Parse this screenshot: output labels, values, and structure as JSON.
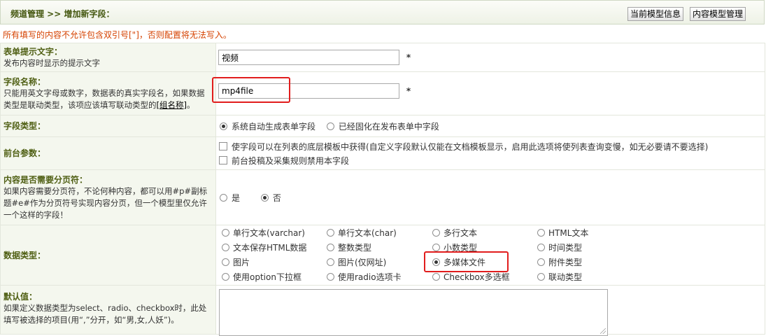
{
  "header": {
    "breadcrumb": "频道管理 >> 增加新字段：",
    "btn_model_info": "当前模型信息",
    "btn_model_manage": "内容模型管理"
  },
  "notice": "所有填写的内容不允许包含双引号[\"]，否则配置将无法写入。",
  "rows": {
    "form_hint": {
      "title": "表单提示文字：",
      "desc": "发布内容时显示的提示文字",
      "value": "视频",
      "required": "*"
    },
    "field_name": {
      "title": "字段名称：",
      "desc_1": "只能用英文字母或数字，数据表的真实字段名，如果数据",
      "desc_2": "类型是联动类型，该项应该填写联动类型的",
      "desc_link": "[组名称]",
      "desc_end": "。",
      "value": "mp4file",
      "required": "*"
    },
    "field_type": {
      "title": "字段类型：",
      "opt_1": "系统自动生成表单字段",
      "opt_2": "已经固化在发布表单中字段",
      "selected": "系统自动生成表单字段"
    },
    "frontend": {
      "title": "前台参数：",
      "chk_1": "使字段可以在列表的底层模板中获得(自定义字段默认仅能在文档模板显示，启用此选项将使列表查询变慢，如无必要请不要选择)",
      "chk_2": "前台投稿及采集规则禁用本字段"
    },
    "pagebreak": {
      "title": "内容是否需要分页符：",
      "desc_1": "如果内容需要分页符，不论何种内容，都可以用#p#副标",
      "desc_2": "题#e#作为分页符号实现内容分页，但一个模型里仅允许",
      "desc_3": "一个这样的字段！",
      "opt_yes": "是",
      "opt_no": "否",
      "selected": "否"
    },
    "data_type": {
      "title": "数据类型：",
      "options": [
        [
          "单行文本(varchar)",
          "单行文本(char)",
          "多行文本",
          "HTML文本"
        ],
        [
          "文本保存HTML数据",
          "整数类型",
          "小数类型",
          "时间类型"
        ],
        [
          "图片",
          "图片(仅网址)",
          "多媒体文件",
          "附件类型"
        ],
        [
          "使用option下拉框",
          "使用radio选项卡",
          "Checkbox多选框",
          "联动类型"
        ]
      ],
      "selected": "多媒体文件"
    },
    "default_value": {
      "title": "默认值：",
      "desc_1": "如果定义数据类型为select、radio、checkbox时，此处",
      "desc_2": "填写被选择的项目(用“,”分开，如“男,女,人妖”)。"
    }
  },
  "colors": {
    "label_bg": "#f4f7ee",
    "label_title": "#4f5f13",
    "notice": "#d54200",
    "highlight": "#e11d1d"
  }
}
